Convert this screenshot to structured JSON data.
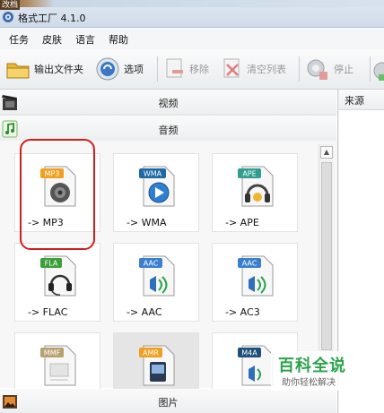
{
  "window": {
    "title": "格式工厂 4.1.0",
    "corner_tag": "改档"
  },
  "menu": [
    "任务",
    "皮肤",
    "语言",
    "帮助"
  ],
  "toolbar": {
    "output_folder": "输出文件夹",
    "options": "选项",
    "remove": "移除",
    "clear_list": "清空列表",
    "stop": "停止"
  },
  "categories": {
    "video": "视频",
    "audio": "音频",
    "picture": "图片"
  },
  "tiles": [
    {
      "badge": "MP3",
      "label": "-> MP3",
      "badge_color": "#f0a020"
    },
    {
      "badge": "WMA",
      "label": "-> WMA",
      "badge_color": "#1f6aa5"
    },
    {
      "badge": "APE",
      "label": "-> APE",
      "badge_color": "#2f9e8f"
    },
    {
      "badge": "FLA",
      "label": "-> FLAC",
      "badge_color": "#3aa03a"
    },
    {
      "badge": "AAC",
      "label": "-> AAC",
      "badge_color": "#3a7fd0"
    },
    {
      "badge": "AAC",
      "label": "-> AC3",
      "badge_color": "#3a7fd0"
    },
    {
      "badge": "MMF",
      "label": "",
      "badge_color": "#b8a070"
    },
    {
      "badge": "AMR",
      "label": "",
      "badge_color": "#f0a020"
    },
    {
      "badge": "M4A",
      "label": "",
      "badge_color": "#1d4f7a"
    }
  ],
  "right_panel": {
    "header": "来源"
  },
  "watermark": {
    "brand": "百科全说",
    "tagline": "助你轻松解决"
  }
}
